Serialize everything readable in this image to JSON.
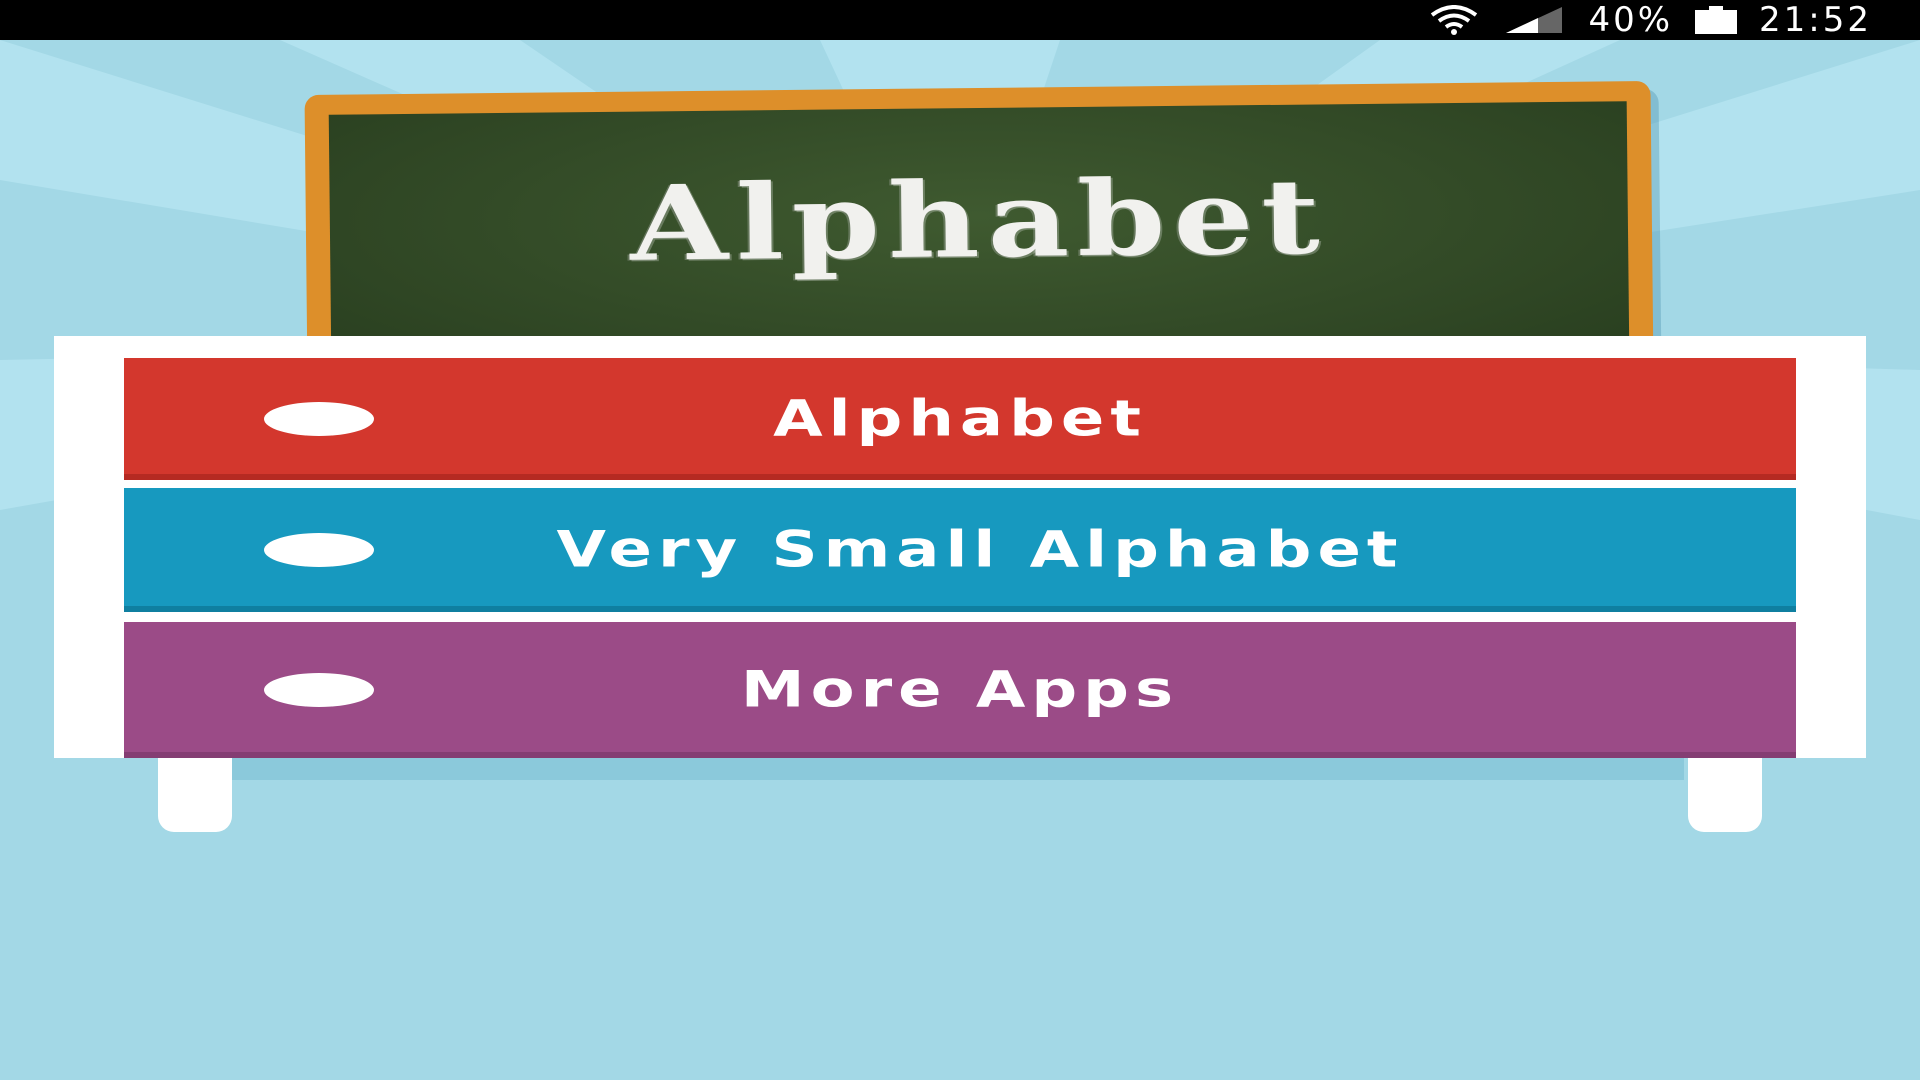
{
  "status_bar": {
    "battery_percent": "40%",
    "time": "21:52",
    "icons": [
      "wifi-icon",
      "signal-icon",
      "battery-icon"
    ]
  },
  "chalkboard": {
    "title": "Alphabet"
  },
  "menu": {
    "items": [
      {
        "label": "Alphabet",
        "color": "#d3372d"
      },
      {
        "label": "Very Small Alphabet",
        "color": "#1799bf"
      },
      {
        "label": "More Apps",
        "color": "#9b4b87"
      }
    ]
  },
  "colors": {
    "background": "#a3d8e6",
    "chalkboard_frame": "#dd8f2a",
    "chalkboard_surface": "#2f4624"
  }
}
